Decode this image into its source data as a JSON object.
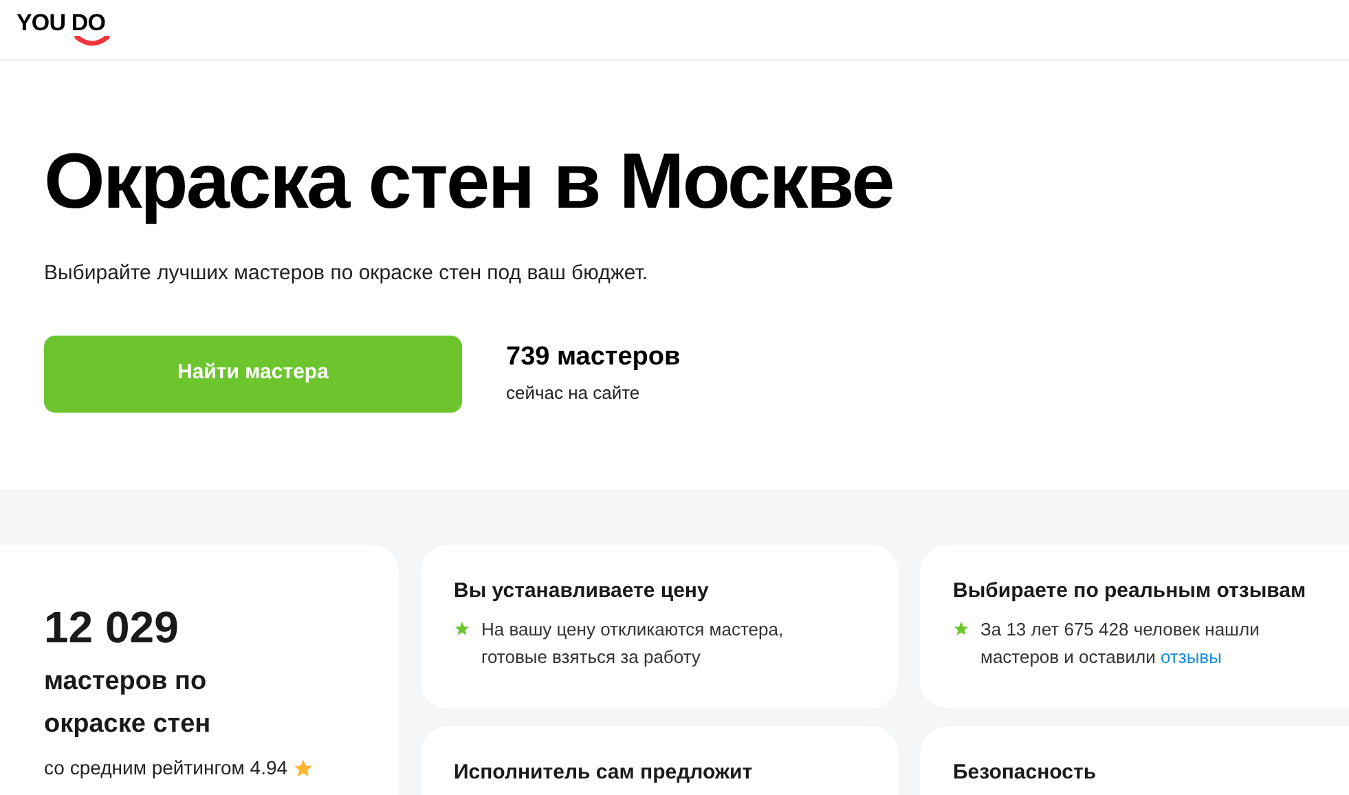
{
  "header": {
    "logo": "YOU DO"
  },
  "hero": {
    "title": "Окраска стен в Москве",
    "subtitle": "Выбирайте лучших мастеров по окраске стен под ваш бюджет.",
    "button": "Найти мастера",
    "count": "739 мастеров",
    "count_caption": "сейчас на сайте"
  },
  "stats": {
    "number": "12 029",
    "label": "мастеров по окраске стен",
    "rating_text": "со средним рейтингом 4.94"
  },
  "features": [
    {
      "title": "Вы устанавливаете цену",
      "text": "На вашу цену откликаются мастера, готовые взяться за работу"
    },
    {
      "title": "Выбираете по реальным отзывам",
      "text": "За 13 лет 675 428 человек нашли мастеров и оставили",
      "link": "отзывы"
    },
    {
      "title": "Исполнитель сам предложит"
    },
    {
      "title": "Безопасность"
    }
  ]
}
